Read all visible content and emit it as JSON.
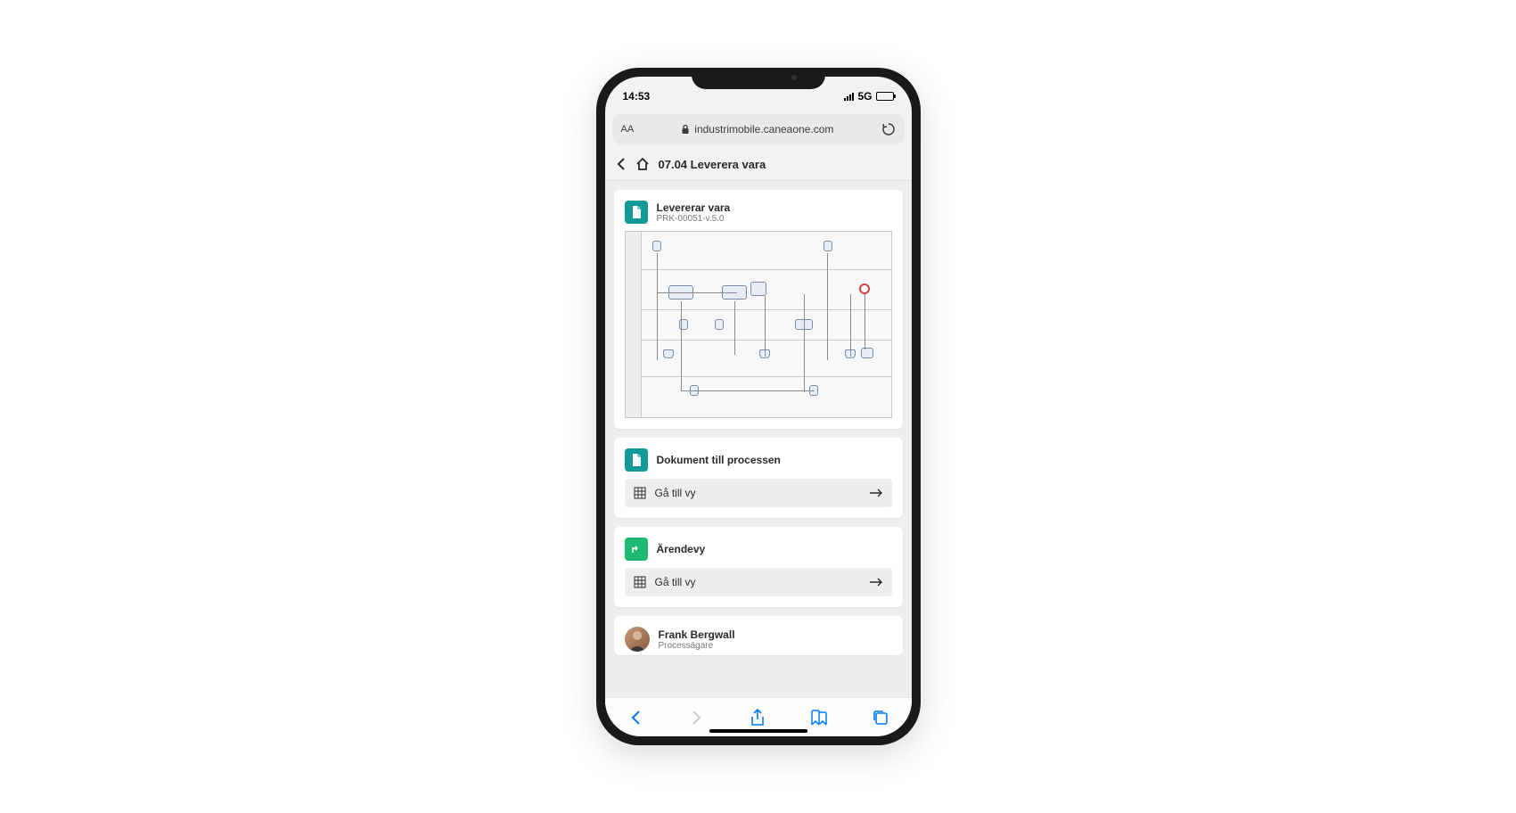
{
  "status": {
    "time": "14:53",
    "network": "5G"
  },
  "browser": {
    "domain": "industrimobile.caneaone.com"
  },
  "header": {
    "breadcrumb": "07.04 Leverera vara"
  },
  "card_process": {
    "title": "Levererar vara",
    "code": "PRK-00051-v.5.0"
  },
  "card_docs": {
    "title": "Dokument till processen",
    "action": "Gå till vy"
  },
  "card_case": {
    "title": "Ärendevy",
    "action": "Gå till vy"
  },
  "card_owner": {
    "name": "Frank Bergwall",
    "role": "Processägare"
  }
}
